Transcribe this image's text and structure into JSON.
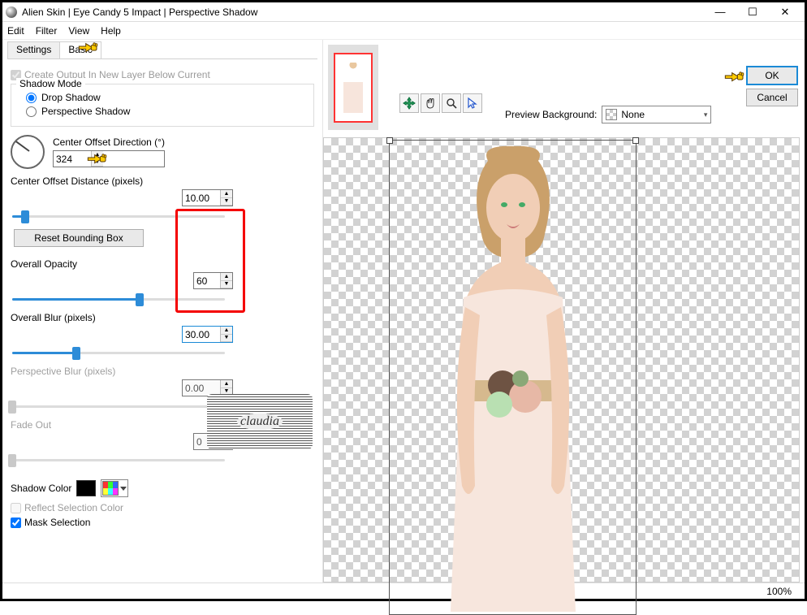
{
  "window": {
    "title": "Alien Skin | Eye Candy 5 Impact | Perspective Shadow"
  },
  "menu": {
    "items": [
      "Edit",
      "Filter",
      "View",
      "Help"
    ]
  },
  "tabs": {
    "settings": "Settings",
    "basic": "Basic"
  },
  "panel": {
    "create_output_label": "Create Output In New Layer Below Current",
    "shadow_mode_legend": "Shadow Mode",
    "drop_shadow_label": "Drop Shadow",
    "perspective_shadow_label": "Perspective Shadow",
    "center_offset_dir_label": "Center Offset Direction (°)",
    "center_offset_dir_value": "324",
    "center_offset_dist_label": "Center Offset Distance (pixels)",
    "center_offset_dist_value": "10.00",
    "reset_bb_label": "Reset Bounding Box",
    "overall_opacity_label": "Overall Opacity",
    "overall_opacity_value": "60",
    "overall_blur_label": "Overall Blur (pixels)",
    "overall_blur_value": "30.00",
    "perspective_blur_label": "Perspective Blur (pixels)",
    "perspective_blur_value": "0.00",
    "fade_out_label": "Fade Out",
    "fade_out_value": "0",
    "shadow_color_label": "Shadow Color",
    "reflect_sel_label": "Reflect Selection Color",
    "mask_sel_label": "Mask Selection"
  },
  "right": {
    "preview_bg_label": "Preview Background:",
    "preview_bg_value": "None",
    "ok_label": "OK",
    "cancel_label": "Cancel"
  },
  "watermark": "claudia",
  "status": {
    "zoom": "100%"
  }
}
